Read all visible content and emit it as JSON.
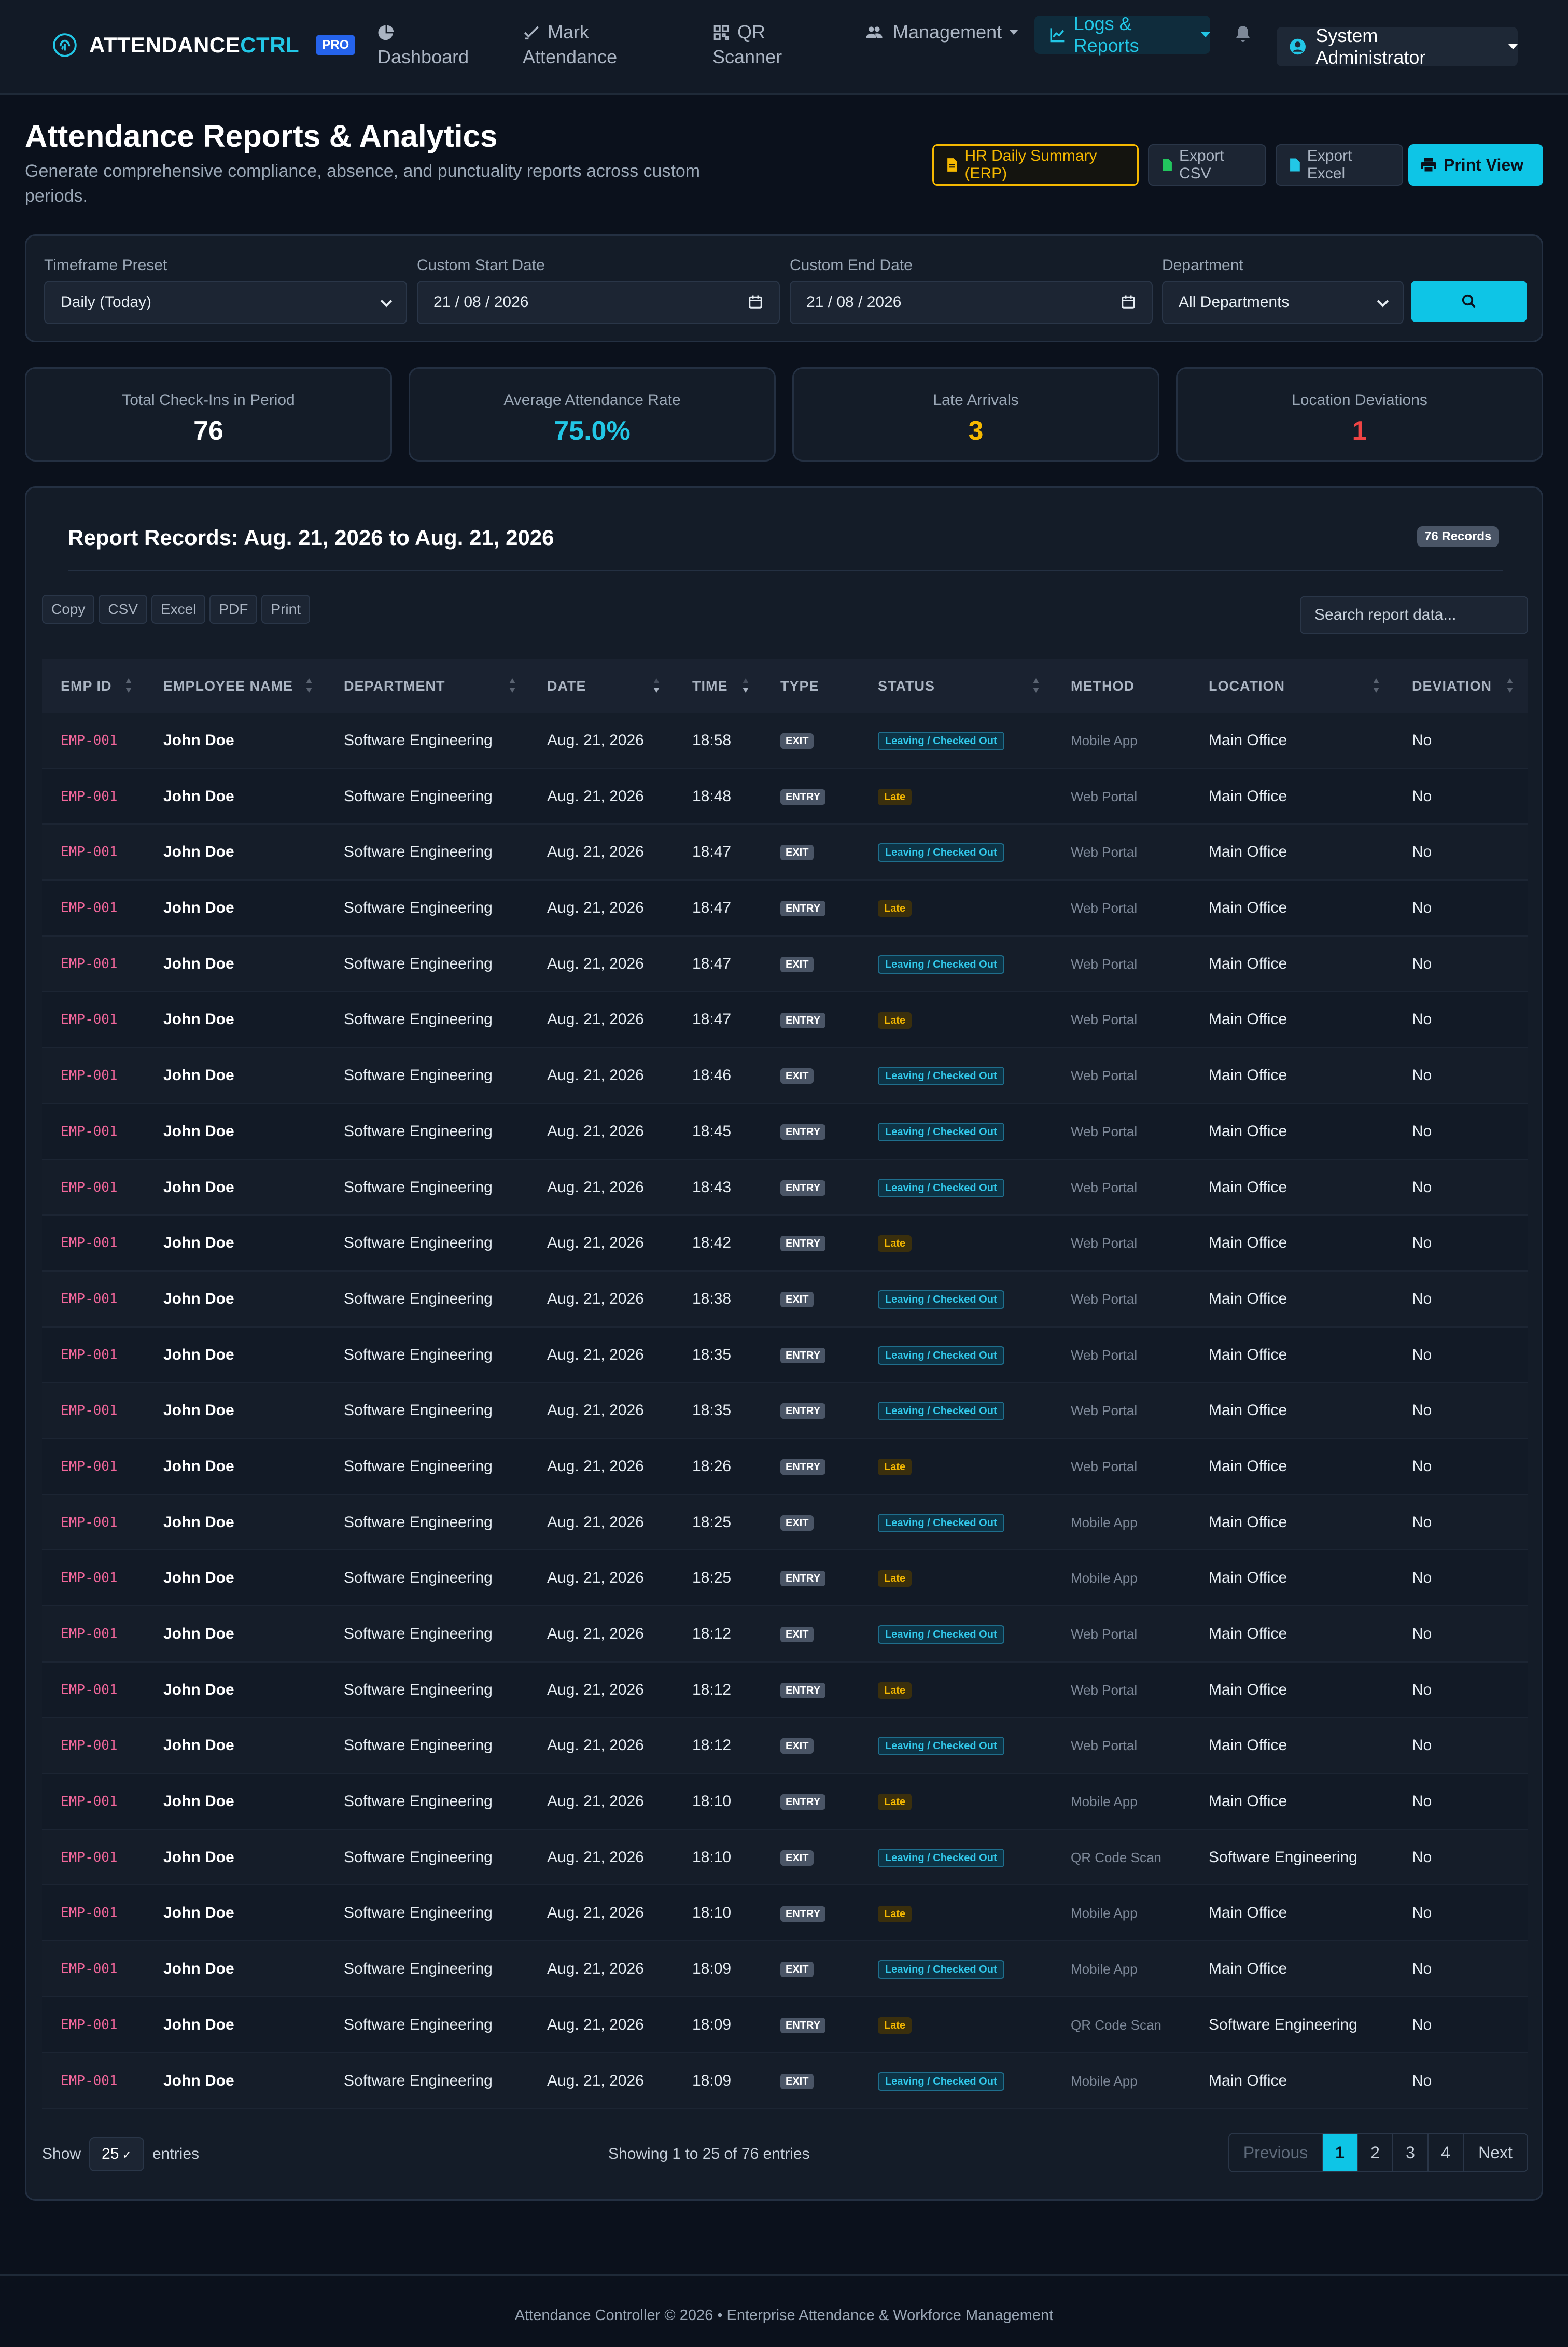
{
  "nav": {
    "brand_white": "ATTENDANCE",
    "brand_cyan": "CTRL",
    "pro_badge": "PRO",
    "items": [
      {
        "label_1": "Dashboard",
        "label_2": ""
      },
      {
        "label_1": "Mark",
        "label_2": "Attendance"
      },
      {
        "label_1": "QR",
        "label_2": "Scanner"
      },
      {
        "label_1": "Management",
        "label_2": ""
      }
    ],
    "active_label": "Logs & Reports",
    "user": "System Administrator"
  },
  "header": {
    "title": "Attendance Reports & Analytics",
    "subtitle": "Generate comprehensive compliance, absence, and punctuality reports across custom periods.",
    "btn_hr": "HR Daily Summary (ERP)",
    "btn_csv": "Export CSV",
    "btn_excel": "Export Excel",
    "btn_print": "Print View"
  },
  "filters": {
    "timeframe_label": "Timeframe Preset",
    "timeframe_value": "Daily (Today)",
    "start_label": "Custom Start Date",
    "start_value": "21 / 08 / 2026",
    "end_label": "Custom End Date",
    "end_value": "21 / 08 / 2026",
    "dept_label": "Department",
    "dept_value": "All Departments"
  },
  "stats": [
    {
      "label": "Total Check-Ins in Period",
      "value": "76",
      "color": "#ffffff"
    },
    {
      "label": "Average Attendance Rate",
      "value": "75.0%",
      "color": "#22c7e6"
    },
    {
      "label": "Late Arrivals",
      "value": "3",
      "color": "#f5b800"
    },
    {
      "label": "Location Deviations",
      "value": "1",
      "color": "#ef4444"
    }
  ],
  "report": {
    "title": "Report Records: Aug. 21, 2026 to Aug. 21, 2026",
    "records_badge": "76 Records",
    "export_buttons": [
      "Copy",
      "CSV",
      "Excel",
      "PDF",
      "Print"
    ],
    "search_placeholder": "Search report data...",
    "columns": [
      "EMP ID",
      "EMPLOYEE NAME",
      "DEPARTMENT",
      "DATE",
      "TIME",
      "TYPE",
      "STATUS",
      "METHOD",
      "LOCATION",
      "DEVIATION"
    ],
    "rows": [
      {
        "emp": "EMP-001",
        "name": "John Doe",
        "dept": "Software Engineering",
        "date": "Aug. 21, 2026",
        "time": "18:58",
        "type": "EXIT",
        "status": "Leaving / Checked Out",
        "method": "Mobile App",
        "loc": "Main Office",
        "dev": "No"
      },
      {
        "emp": "EMP-001",
        "name": "John Doe",
        "dept": "Software Engineering",
        "date": "Aug. 21, 2026",
        "time": "18:48",
        "type": "ENTRY",
        "status": "Late",
        "method": "Web Portal",
        "loc": "Main Office",
        "dev": "No"
      },
      {
        "emp": "EMP-001",
        "name": "John Doe",
        "dept": "Software Engineering",
        "date": "Aug. 21, 2026",
        "time": "18:47",
        "type": "EXIT",
        "status": "Leaving / Checked Out",
        "method": "Web Portal",
        "loc": "Main Office",
        "dev": "No"
      },
      {
        "emp": "EMP-001",
        "name": "John Doe",
        "dept": "Software Engineering",
        "date": "Aug. 21, 2026",
        "time": "18:47",
        "type": "ENTRY",
        "status": "Late",
        "method": "Web Portal",
        "loc": "Main Office",
        "dev": "No"
      },
      {
        "emp": "EMP-001",
        "name": "John Doe",
        "dept": "Software Engineering",
        "date": "Aug. 21, 2026",
        "time": "18:47",
        "type": "EXIT",
        "status": "Leaving / Checked Out",
        "method": "Web Portal",
        "loc": "Main Office",
        "dev": "No"
      },
      {
        "emp": "EMP-001",
        "name": "John Doe",
        "dept": "Software Engineering",
        "date": "Aug. 21, 2026",
        "time": "18:47",
        "type": "ENTRY",
        "status": "Late",
        "method": "Web Portal",
        "loc": "Main Office",
        "dev": "No"
      },
      {
        "emp": "EMP-001",
        "name": "John Doe",
        "dept": "Software Engineering",
        "date": "Aug. 21, 2026",
        "time": "18:46",
        "type": "EXIT",
        "status": "Leaving / Checked Out",
        "method": "Web Portal",
        "loc": "Main Office",
        "dev": "No"
      },
      {
        "emp": "EMP-001",
        "name": "John Doe",
        "dept": "Software Engineering",
        "date": "Aug. 21, 2026",
        "time": "18:45",
        "type": "ENTRY",
        "status": "Leaving / Checked Out",
        "method": "Web Portal",
        "loc": "Main Office",
        "dev": "No"
      },
      {
        "emp": "EMP-001",
        "name": "John Doe",
        "dept": "Software Engineering",
        "date": "Aug. 21, 2026",
        "time": "18:43",
        "type": "ENTRY",
        "status": "Leaving / Checked Out",
        "method": "Web Portal",
        "loc": "Main Office",
        "dev": "No"
      },
      {
        "emp": "EMP-001",
        "name": "John Doe",
        "dept": "Software Engineering",
        "date": "Aug. 21, 2026",
        "time": "18:42",
        "type": "ENTRY",
        "status": "Late",
        "method": "Web Portal",
        "loc": "Main Office",
        "dev": "No"
      },
      {
        "emp": "EMP-001",
        "name": "John Doe",
        "dept": "Software Engineering",
        "date": "Aug. 21, 2026",
        "time": "18:38",
        "type": "EXIT",
        "status": "Leaving / Checked Out",
        "method": "Web Portal",
        "loc": "Main Office",
        "dev": "No"
      },
      {
        "emp": "EMP-001",
        "name": "John Doe",
        "dept": "Software Engineering",
        "date": "Aug. 21, 2026",
        "time": "18:35",
        "type": "ENTRY",
        "status": "Leaving / Checked Out",
        "method": "Web Portal",
        "loc": "Main Office",
        "dev": "No"
      },
      {
        "emp": "EMP-001",
        "name": "John Doe",
        "dept": "Software Engineering",
        "date": "Aug. 21, 2026",
        "time": "18:35",
        "type": "ENTRY",
        "status": "Leaving / Checked Out",
        "method": "Web Portal",
        "loc": "Main Office",
        "dev": "No"
      },
      {
        "emp": "EMP-001",
        "name": "John Doe",
        "dept": "Software Engineering",
        "date": "Aug. 21, 2026",
        "time": "18:26",
        "type": "ENTRY",
        "status": "Late",
        "method": "Web Portal",
        "loc": "Main Office",
        "dev": "No"
      },
      {
        "emp": "EMP-001",
        "name": "John Doe",
        "dept": "Software Engineering",
        "date": "Aug. 21, 2026",
        "time": "18:25",
        "type": "EXIT",
        "status": "Leaving / Checked Out",
        "method": "Mobile App",
        "loc": "Main Office",
        "dev": "No"
      },
      {
        "emp": "EMP-001",
        "name": "John Doe",
        "dept": "Software Engineering",
        "date": "Aug. 21, 2026",
        "time": "18:25",
        "type": "ENTRY",
        "status": "Late",
        "method": "Mobile App",
        "loc": "Main Office",
        "dev": "No"
      },
      {
        "emp": "EMP-001",
        "name": "John Doe",
        "dept": "Software Engineering",
        "date": "Aug. 21, 2026",
        "time": "18:12",
        "type": "EXIT",
        "status": "Leaving / Checked Out",
        "method": "Web Portal",
        "loc": "Main Office",
        "dev": "No"
      },
      {
        "emp": "EMP-001",
        "name": "John Doe",
        "dept": "Software Engineering",
        "date": "Aug. 21, 2026",
        "time": "18:12",
        "type": "ENTRY",
        "status": "Late",
        "method": "Web Portal",
        "loc": "Main Office",
        "dev": "No"
      },
      {
        "emp": "EMP-001",
        "name": "John Doe",
        "dept": "Software Engineering",
        "date": "Aug. 21, 2026",
        "time": "18:12",
        "type": "EXIT",
        "status": "Leaving / Checked Out",
        "method": "Web Portal",
        "loc": "Main Office",
        "dev": "No"
      },
      {
        "emp": "EMP-001",
        "name": "John Doe",
        "dept": "Software Engineering",
        "date": "Aug. 21, 2026",
        "time": "18:10",
        "type": "ENTRY",
        "status": "Late",
        "method": "Mobile App",
        "loc": "Main Office",
        "dev": "No"
      },
      {
        "emp": "EMP-001",
        "name": "John Doe",
        "dept": "Software Engineering",
        "date": "Aug. 21, 2026",
        "time": "18:10",
        "type": "EXIT",
        "status": "Leaving / Checked Out",
        "method": "QR Code Scan",
        "loc": "Software Engineering",
        "dev": "No"
      },
      {
        "emp": "EMP-001",
        "name": "John Doe",
        "dept": "Software Engineering",
        "date": "Aug. 21, 2026",
        "time": "18:10",
        "type": "ENTRY",
        "status": "Late",
        "method": "Mobile App",
        "loc": "Main Office",
        "dev": "No"
      },
      {
        "emp": "EMP-001",
        "name": "John Doe",
        "dept": "Software Engineering",
        "date": "Aug. 21, 2026",
        "time": "18:09",
        "type": "EXIT",
        "status": "Leaving / Checked Out",
        "method": "Mobile App",
        "loc": "Main Office",
        "dev": "No"
      },
      {
        "emp": "EMP-001",
        "name": "John Doe",
        "dept": "Software Engineering",
        "date": "Aug. 21, 2026",
        "time": "18:09",
        "type": "ENTRY",
        "status": "Late",
        "method": "QR Code Scan",
        "loc": "Software Engineering",
        "dev": "No"
      },
      {
        "emp": "EMP-001",
        "name": "John Doe",
        "dept": "Software Engineering",
        "date": "Aug. 21, 2026",
        "time": "18:09",
        "type": "EXIT",
        "status": "Leaving / Checked Out",
        "method": "Mobile App",
        "loc": "Main Office",
        "dev": "No"
      }
    ],
    "show_label": "Show",
    "page_length": "25",
    "entries_label": "entries",
    "info": "Showing 1 to 25 of 76 entries",
    "pager": {
      "prev": "Previous",
      "pages": [
        "1",
        "2",
        "3",
        "4"
      ],
      "active": "1",
      "next": "Next"
    }
  },
  "footer": "Attendance Controller © 2026 • Enterprise Attendance & Workforce Management"
}
